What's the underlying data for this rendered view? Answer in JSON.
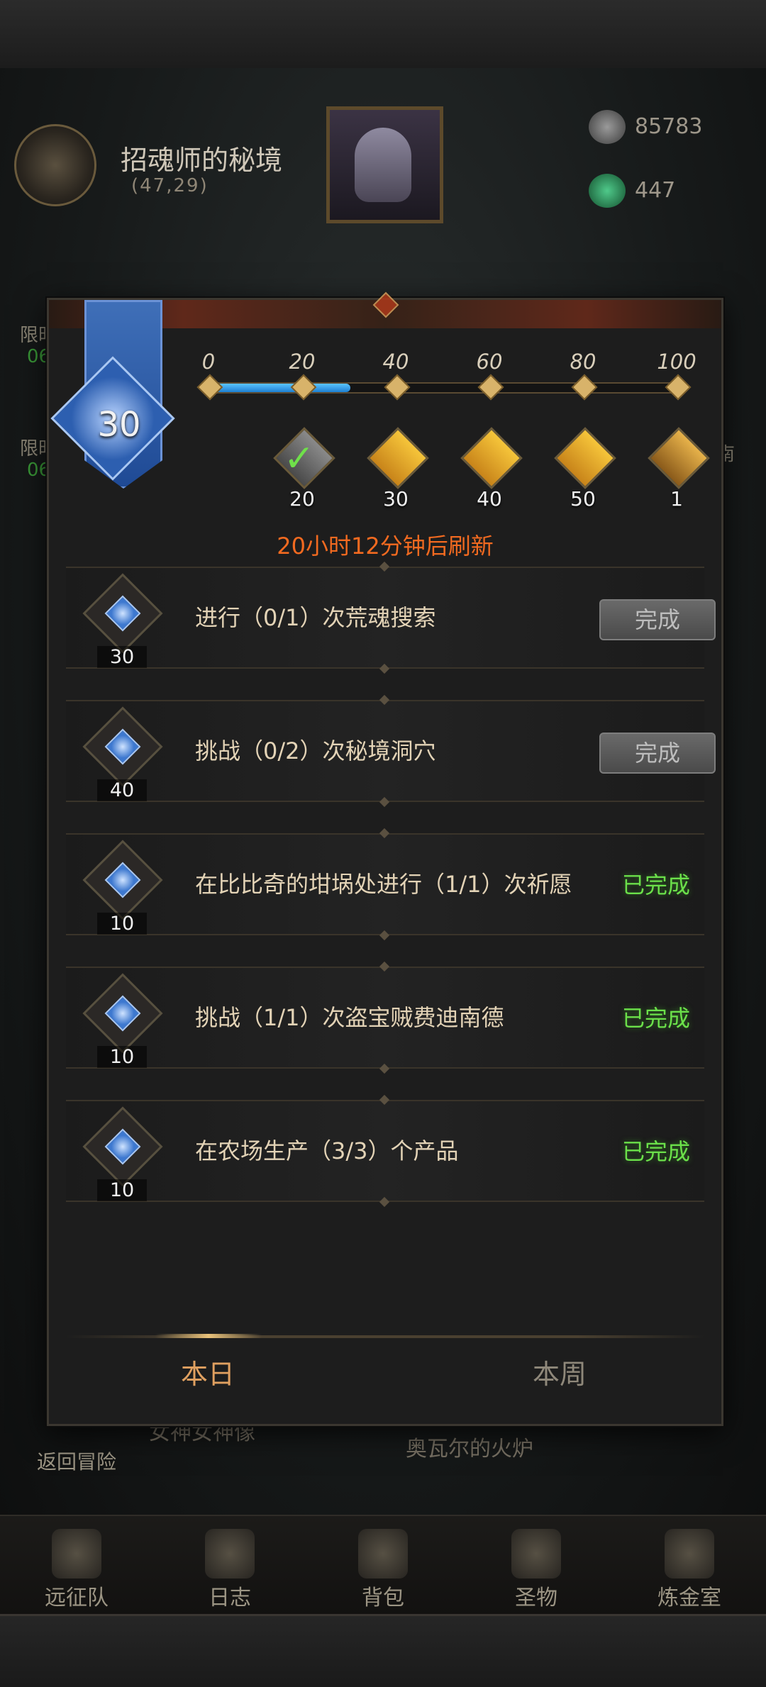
{
  "hud": {
    "location_name": "招魂师的秘境",
    "location_coords": "(47,29)",
    "currency_1": "85783",
    "currency_2": "447"
  },
  "background": {
    "side_items": [
      "限时",
      "06",
      "限时",
      "06",
      "南"
    ],
    "under_labels": [
      "返回冒险",
      "女神女神像",
      "奥瓦尔的火炉"
    ]
  },
  "nav": {
    "items": [
      {
        "label": "远征队",
        "icon": "helmet-icon"
      },
      {
        "label": "日志",
        "icon": "scroll-icon"
      },
      {
        "label": "背包",
        "icon": "bag-icon"
      },
      {
        "label": "圣物",
        "icon": "torch-icon"
      },
      {
        "label": "炼金室",
        "icon": "alchemy-icon"
      }
    ]
  },
  "modal": {
    "level": "30",
    "progress": {
      "value": 30,
      "max": 100,
      "ticks": [
        "0",
        "20",
        "40",
        "60",
        "80",
        "100"
      ]
    },
    "rewards": [
      {
        "at": 20,
        "count": "20",
        "icon": "scroll-icon",
        "claimed": true
      },
      {
        "at": 40,
        "count": "30",
        "icon": "scroll-icon",
        "claimed": false
      },
      {
        "at": 60,
        "count": "40",
        "icon": "scroll-icon",
        "claimed": false
      },
      {
        "at": 80,
        "count": "50",
        "icon": "scroll-icon",
        "claimed": false
      },
      {
        "at": 100,
        "count": "1",
        "icon": "gold-pile-icon",
        "claimed": false
      }
    ],
    "refresh_text": "20小时12分钟后刷新",
    "tasks": [
      {
        "points": "30",
        "desc": "进行（0/1）次荒魂搜索",
        "status": "button",
        "status_label": "完成"
      },
      {
        "points": "40",
        "desc": "挑战（0/2）次秘境洞穴",
        "status": "button",
        "status_label": "完成"
      },
      {
        "points": "10",
        "desc": "在比比奇的坩埚处进行（1/1）次祈愿",
        "status": "done",
        "status_label": "已完成"
      },
      {
        "points": "10",
        "desc": "挑战（1/1）次盗宝贼费迪南德",
        "status": "done",
        "status_label": "已完成"
      },
      {
        "points": "10",
        "desc": "在农场生产（3/3）个产品",
        "status": "done",
        "status_label": "已完成"
      }
    ],
    "tabs": [
      {
        "label": "本日",
        "active": true
      },
      {
        "label": "本周",
        "active": false
      }
    ]
  },
  "colors": {
    "accent_orange": "#f26a20",
    "done_green": "#6be04a",
    "progress_blue": "#1e7fd0"
  }
}
